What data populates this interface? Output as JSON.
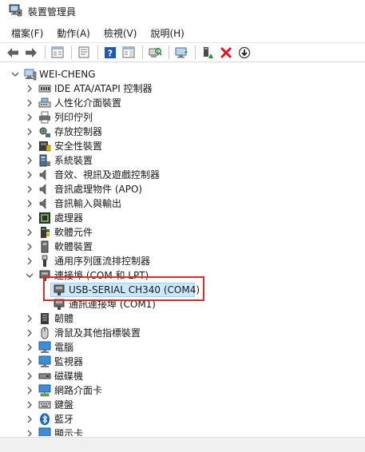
{
  "window": {
    "title": "裝置管理員"
  },
  "menu": [
    {
      "label": "檔案(F)"
    },
    {
      "label": "動作(A)"
    },
    {
      "label": "檢視(V)"
    },
    {
      "label": "說明(H)"
    }
  ],
  "toolbar": [
    {
      "name": "back-button",
      "icon": "arrow-left-icon"
    },
    {
      "name": "forward-button",
      "icon": "arrow-right-icon"
    },
    {
      "name": "show-hide-console-tree-button",
      "icon": "console-tree-icon"
    },
    {
      "name": "properties-button",
      "icon": "properties-icon"
    },
    {
      "name": "help-button",
      "icon": "help-icon"
    },
    {
      "name": "action-pane-button",
      "icon": "action-pane-icon"
    },
    {
      "name": "scan-hardware-button",
      "icon": "scan-hardware-icon"
    },
    {
      "name": "update-driver-button",
      "icon": "update-driver-icon"
    },
    {
      "name": "enable-device-button",
      "icon": "enable-device-icon"
    },
    {
      "name": "uninstall-device-button",
      "icon": "red-x-icon"
    },
    {
      "name": "disable-device-button",
      "icon": "download-circle-icon"
    }
  ],
  "tree": {
    "root": {
      "label": "WEI-CHENG",
      "icon": "computer-icon",
      "expanded": true
    },
    "items": [
      {
        "label": "IDE ATA/ATAPI 控制器",
        "icon": "ide-controller-icon",
        "expanded": false
      },
      {
        "label": "人性化介面裝置",
        "icon": "hid-icon",
        "expanded": false
      },
      {
        "label": "列印佇列",
        "icon": "printer-icon",
        "expanded": false
      },
      {
        "label": "存放控制器",
        "icon": "storage-controller-icon",
        "expanded": false
      },
      {
        "label": "安全性裝置",
        "icon": "security-device-icon",
        "expanded": false
      },
      {
        "label": "系統裝置",
        "icon": "system-device-icon",
        "expanded": false
      },
      {
        "label": "音效、視訊及遊戲控制器",
        "icon": "speaker-icon",
        "expanded": false
      },
      {
        "label": "音訊處理物件 (APO)",
        "icon": "speaker-icon",
        "expanded": false
      },
      {
        "label": "音訊輸入與輸出",
        "icon": "speaker-icon",
        "expanded": false
      },
      {
        "label": "處理器",
        "icon": "processor-icon",
        "expanded": false
      },
      {
        "label": "軟體元件",
        "icon": "software-component-icon",
        "expanded": false
      },
      {
        "label": "軟體裝置",
        "icon": "software-device-icon",
        "expanded": false
      },
      {
        "label": "通用序列匯流排控制器",
        "icon": "usb-connector-icon",
        "expanded": false
      },
      {
        "label": "連接埠 (COM 和 LPT)",
        "icon": "port-icon",
        "expanded": true,
        "children": [
          {
            "label": "USB-SERIAL CH340 (COM4)",
            "icon": "port-icon",
            "selected": true
          },
          {
            "label": "通訊連接埠 (COM1)",
            "icon": "port-icon",
            "selected": false
          }
        ]
      },
      {
        "label": "韌體",
        "icon": "firmware-icon",
        "expanded": false
      },
      {
        "label": "滑鼠及其他指標裝置",
        "icon": "mouse-icon",
        "expanded": false
      },
      {
        "label": "電腦",
        "icon": "computer-monitor-icon",
        "expanded": false
      },
      {
        "label": "監視器",
        "icon": "monitor-icon",
        "expanded": false
      },
      {
        "label": "磁碟機",
        "icon": "disk-drive-icon",
        "expanded": false
      },
      {
        "label": "網路介面卡",
        "icon": "network-adapter-icon",
        "expanded": false
      },
      {
        "label": "鍵盤",
        "icon": "keyboard-icon",
        "expanded": false
      },
      {
        "label": "藍牙",
        "icon": "bluetooth-icon",
        "expanded": false
      },
      {
        "label": "顯示卡",
        "icon": "display-adapter-icon",
        "expanded": false
      }
    ]
  },
  "colors": {
    "selection_bg": "#cce8ff",
    "selection_border": "#99d1ff",
    "highlight_box": "#d32f2f",
    "toolbar_arrow": "#4a4a4a",
    "help_blue": "#1e5ab4",
    "delete_red": "#e81123",
    "enable_green": "#2b8a3e"
  }
}
